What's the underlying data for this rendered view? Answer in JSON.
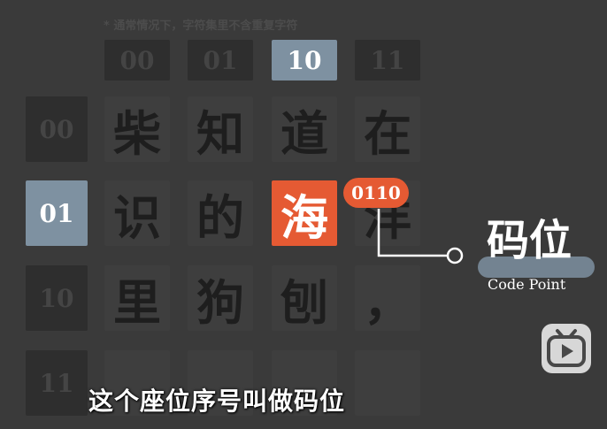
{
  "note": "* 通常情况下，字符集里不含重复字符",
  "columns": [
    "00",
    "01",
    "10",
    "11"
  ],
  "rows": [
    "00",
    "01",
    "10",
    "11"
  ],
  "grid": [
    [
      "柴",
      "知",
      "道",
      "在"
    ],
    [
      "识",
      "的",
      "海",
      "洋"
    ],
    [
      "里",
      "狗",
      "刨",
      "，"
    ],
    [
      "",
      "",
      "",
      ""
    ]
  ],
  "highlight": {
    "row": "01",
    "column": "10",
    "char": "海",
    "code": "0110",
    "color": "#e55a33"
  },
  "selected_color": "#7e91a1",
  "callout": {
    "title": "码位",
    "subtitle": "Code Point"
  },
  "subtitle": "这个座位序号叫做码位",
  "logo_icon": "bilibili-tv-icon"
}
